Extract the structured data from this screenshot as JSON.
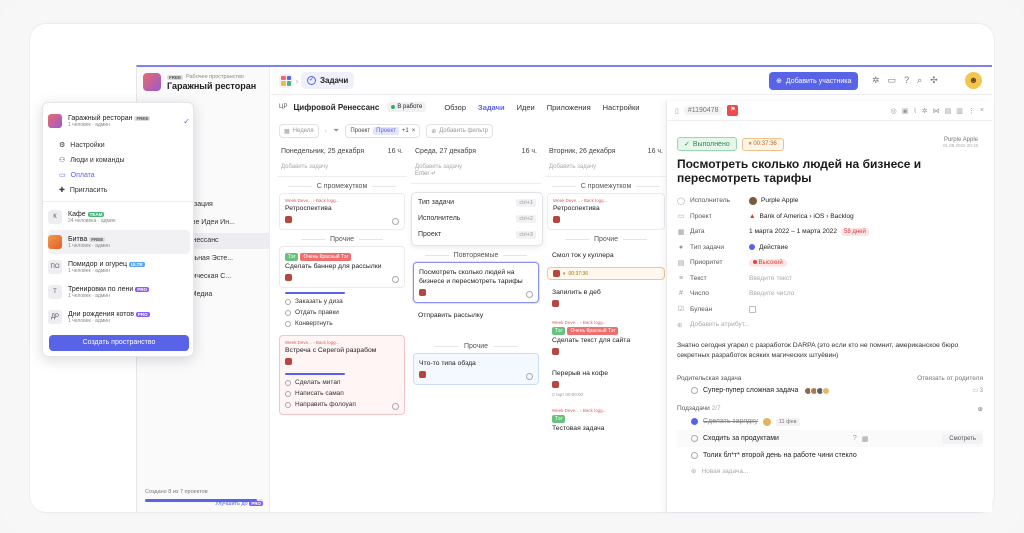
{
  "workspace": {
    "label": "Рабочее пространство",
    "badge": "FREE",
    "name": "Гаражный ресторан"
  },
  "topbar": {
    "tab": "Задачи",
    "add_member": "Добавить участника"
  },
  "project": {
    "code": "ЦР",
    "name": "Цифровой Ренессанс",
    "status": "В работе",
    "tabs": [
      "Обзор",
      "Задачи",
      "Идеи",
      "Приложения",
      "Настройки"
    ]
  },
  "filters": {
    "week": "Неделя",
    "project_label": "Проект",
    "project_value": "Проект",
    "plus": "+1",
    "add_filter": "Добавить фильтр"
  },
  "sidebar": {
    "items": [
      "Визуализация",
      "ационные Идеи Ин...",
      "овой Ренессанс",
      "ациональная Эсте...",
      "Стратегическая С...",
      "ьность Медиа",
      "ты",
      "ы"
    ],
    "footer": "Создано 8 из 7 проектов",
    "upgrade": "Улучшить до",
    "progress": 0.95
  },
  "popup": {
    "current": {
      "name": "Гаражный ресторан",
      "badge": "FREE",
      "sub": "1 человек · админ"
    },
    "menu": [
      "Настройки",
      "Люди и команды",
      "Оплата",
      "Пригласить"
    ],
    "workspaces": [
      {
        "initial": "К",
        "name": "Кафе",
        "badge": "TEAM",
        "sub": "24 человека · админ"
      },
      {
        "initial": "",
        "name": "Битва",
        "badge": "FREE",
        "sub": "1 человек · админ"
      },
      {
        "initial": "ПО",
        "name": "Помидор и огурец",
        "badge": "ULTR",
        "sub": "1 человек · админ"
      },
      {
        "initial": "Т",
        "name": "Тренировки по лени",
        "badge": "PRO",
        "sub": "1 человек · админ"
      },
      {
        "initial": "ДР",
        "name": "Дни рождения котов",
        "badge": "PRO",
        "sub": "1 человек · админ"
      }
    ],
    "create": "Создать пространство"
  },
  "columns": [
    {
      "date": "Понедельник, 25 декабря",
      "hours": "16 ч.",
      "add": "Добавить задачу",
      "groups": [
        "С промежутком",
        "Прочие"
      ],
      "cards": [
        {
          "meta": "Week Deve... › Back logg...",
          "title": "Ретроспектива"
        },
        {
          "tags": [
            "Тэг",
            "Очень Красный Тэг"
          ],
          "title": "Сделать баннер для рассылки"
        },
        {
          "meta": "Week Deve... › Back logg...",
          "title": "Встреча с Серегой разрабом"
        }
      ],
      "subs1": [
        "Заказать у диза",
        "Отдать правки",
        "Конвертнуть"
      ],
      "subs2": [
        "Сделать митап",
        "Написать самап",
        "Направить фолоуап"
      ]
    },
    {
      "date": "Среда, 27 декабря",
      "hours": "16 ч.",
      "add": "Добавить задачу",
      "enter": "Enter ↵",
      "groups": [
        "Повторяемые",
        "Прочие"
      ],
      "cards": [
        {
          "title": "Посмотреть сколько людей на бизнесе и пересмотреть тарифы"
        },
        {
          "title": "Отправить рассылку"
        },
        {
          "title": "Что-то типа обзда"
        }
      ]
    },
    {
      "date": "Вторник, 26 декабря",
      "hours": "16 ч.",
      "add": "Добавить задачу",
      "groups": [
        "С промежутком",
        "Прочие"
      ],
      "cards": [
        {
          "meta": "Week Deve... › Back logg...",
          "title": "Ретроспектива"
        },
        {
          "title": "Смол ток у куллера",
          "timer": "00:37:36"
        },
        {
          "title": "Запилить в деб"
        },
        {
          "meta": "Week Deve... › Back logg...",
          "tags": [
            "Тэг",
            "Очень Красный Тэг"
          ],
          "title": "Сделать текст для сайта"
        },
        {
          "title": "Перерыв на кофе",
          "start": "Старт 00:00:00"
        },
        {
          "meta": "Week Deve... › Back logg...",
          "tags": [
            "Тэг"
          ],
          "title": "Тестовая задача"
        }
      ]
    }
  ],
  "type_menu": [
    {
      "label": "Тип задачи",
      "key": "ctrl+1"
    },
    {
      "label": "Исполнитель",
      "key": "ctrl+2"
    },
    {
      "label": "Проект",
      "key": "ctrl+3"
    }
  ],
  "detail": {
    "id": "#1190478",
    "status": "Выполнено",
    "timer": "00:37:36",
    "author": "Purple Apple",
    "author_date": "01.08.2022 20:15",
    "title": "Посмотреть сколько людей на бизнесе и пересмотреть тарифы",
    "fields": [
      {
        "label": "Исполнитель",
        "value": "Purple Apple"
      },
      {
        "label": "Проект",
        "value": "Bank of America  ›  iOS  ›  Backlog"
      },
      {
        "label": "Дата",
        "value": "1 марта 2022  –  1 марта 2022",
        "extra": "58 дней"
      },
      {
        "label": "Тип задачи",
        "value": "Действие"
      },
      {
        "label": "Приоритет",
        "value": "Высокий"
      },
      {
        "label": "Текст",
        "value": "Введите текст"
      },
      {
        "label": "Число",
        "value": "Введите число"
      },
      {
        "label": "Булеан",
        "value": ""
      }
    ],
    "add_attr": "Добавить атрибут...",
    "description": "Знатно сегодня угарел с разработок DARPA (это если кто не помнит, американское бюро секретных разработок всяких магических штуёвин)",
    "parent_label": "Родительская задача",
    "unbind": "Отвязать от родителя",
    "parent_task": "Супер-пупер сложная задача",
    "parent_count": "3",
    "subtasks_label": "Подзадачи",
    "subtasks_count": "2/7",
    "subtasks": [
      {
        "title": "Сделать зарядку",
        "extra": "11 фев",
        "done": true
      },
      {
        "title": "Сходить за продуктами",
        "done": false
      },
      {
        "title": "Толик бл*т* второй день на работе чини стекло",
        "done": false
      }
    ],
    "look": "Смотреть",
    "new_task": "Новая задача..."
  },
  "colors": {
    "accent": "#5863e8",
    "red": "#ef4b4b",
    "green": "#2b8d48"
  }
}
